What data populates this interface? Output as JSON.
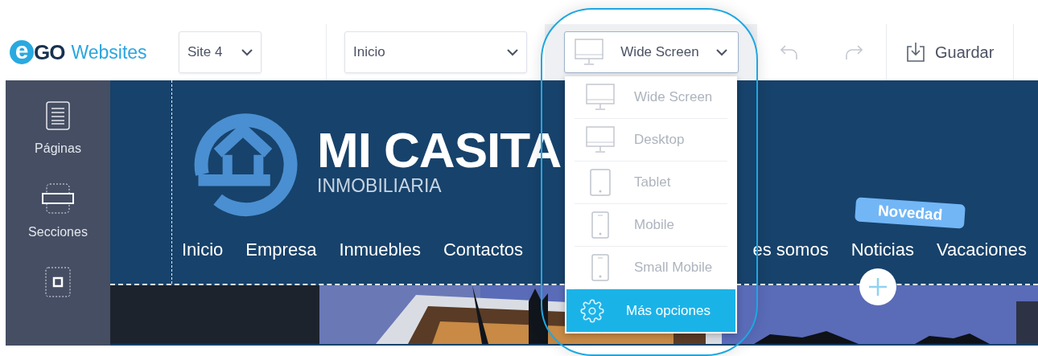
{
  "logo": {
    "mark_letter": "e",
    "mark_rest": "GO",
    "name": "Websites"
  },
  "site_select": {
    "value": "Site 4"
  },
  "page_select": {
    "value": "Inicio"
  },
  "device_select": {
    "value": "Wide Screen",
    "kind": "monitor",
    "expanded": true
  },
  "device_menu": [
    {
      "label": "Wide Screen",
      "kind": "monitor",
      "selected": false
    },
    {
      "label": "Desktop",
      "kind": "monitor",
      "selected": false
    },
    {
      "label": "Tablet",
      "kind": "tablet",
      "selected": false
    },
    {
      "label": "Mobile",
      "kind": "phone",
      "selected": false
    },
    {
      "label": "Small Mobile",
      "kind": "phone",
      "selected": false
    },
    {
      "label": "Más opciones",
      "kind": "settings",
      "selected": true
    }
  ],
  "undo": {
    "disabled": true
  },
  "redo": {
    "disabled": true
  },
  "save_button": {
    "label": "Guardar"
  },
  "sidebar": {
    "items": [
      {
        "label": "Páginas",
        "kind": "pages"
      },
      {
        "label": "Secciones",
        "kind": "sections"
      },
      {
        "kind": "elements"
      }
    ]
  },
  "site_header": {
    "brand": "MI CASITA",
    "tagline": "INMOBILIARIA",
    "badge": "Novedad",
    "nav": [
      "Inicio",
      "Empresa",
      "Inmuebles",
      "Contactos",
      "es somos",
      "Noticias",
      "Vacaciones"
    ]
  }
}
